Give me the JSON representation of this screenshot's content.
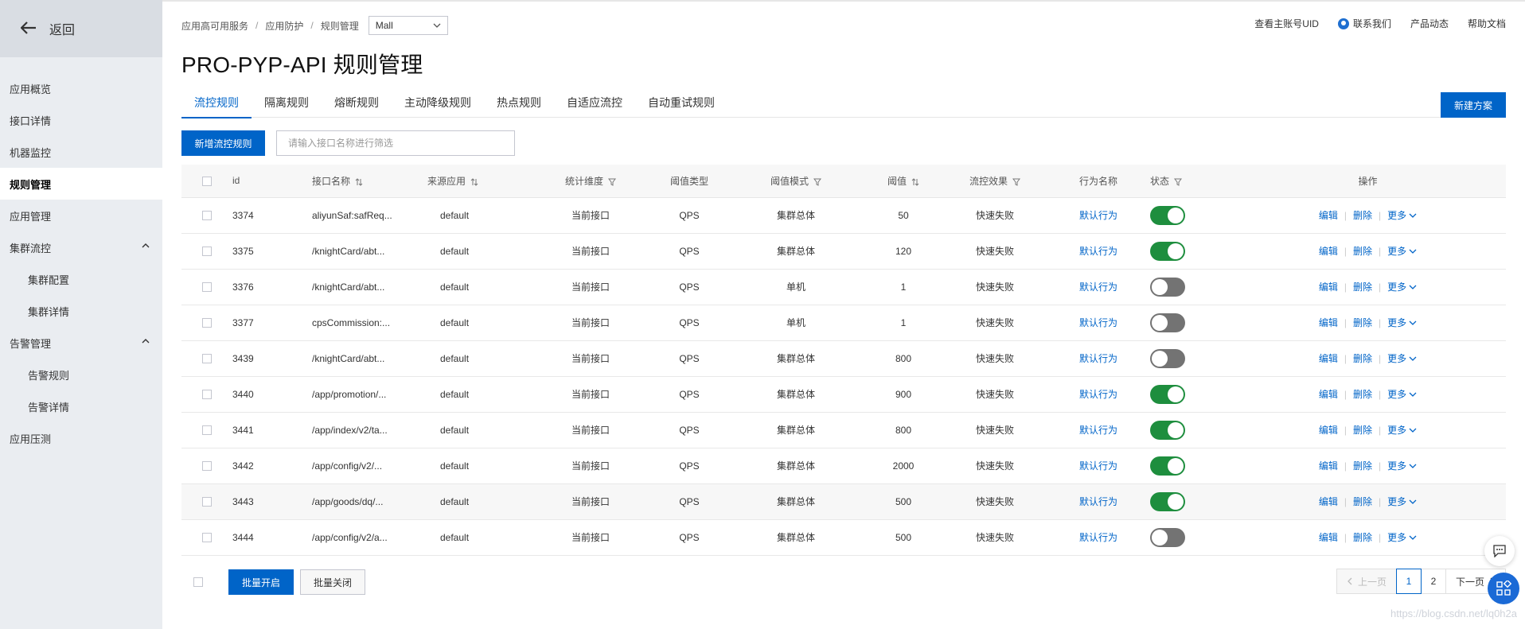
{
  "sidebar": {
    "back_label": "返回",
    "items": [
      {
        "label": "应用概览"
      },
      {
        "label": "接口详情"
      },
      {
        "label": "机器监控"
      },
      {
        "label": "规则管理"
      },
      {
        "label": "应用管理"
      },
      {
        "label": "集群流控"
      },
      {
        "label": "集群配置"
      },
      {
        "label": "集群详情"
      },
      {
        "label": "告警管理"
      },
      {
        "label": "告警规则"
      },
      {
        "label": "告警详情"
      },
      {
        "label": "应用压测"
      }
    ]
  },
  "breadcrumb": {
    "items": [
      "应用高可用服务",
      "应用防护",
      "规则管理"
    ],
    "separator": "/",
    "app_select_value": "Mall"
  },
  "top_links": {
    "uid": "查看主账号UID",
    "contact": "联系我们",
    "news": "产品动态",
    "help": "帮助文档"
  },
  "page_title": "PRO-PYP-API 规则管理",
  "tabs": [
    {
      "label": "流控规则"
    },
    {
      "label": "隔离规则"
    },
    {
      "label": "熔断规则"
    },
    {
      "label": "主动降级规则"
    },
    {
      "label": "热点规则"
    },
    {
      "label": "自适应流控"
    },
    {
      "label": "自动重试规则"
    }
  ],
  "new_plan_label": "新建方案",
  "toolbar": {
    "add_label": "新增流控规则",
    "filter_placeholder": "请输入接口名称进行筛选"
  },
  "table": {
    "headers": {
      "id": "id",
      "name": "接口名称",
      "source": "来源应用",
      "dimension": "统计维度",
      "threshold_type": "阈值类型",
      "threshold_mode": "阈值模式",
      "threshold": "阈值",
      "effect": "流控效果",
      "action": "行为名称",
      "status": "状态",
      "ops": "操作"
    },
    "ops_labels": {
      "edit": "编辑",
      "delete": "删除",
      "more": "更多"
    },
    "rows": [
      {
        "id": "3374",
        "name": "aliyunSaf:safReq...",
        "source": "default",
        "dimension": "当前接口",
        "threshold_type": "QPS",
        "threshold_mode": "集群总体",
        "threshold": "50",
        "effect": "快速失败",
        "action": "默认行为",
        "status": "on"
      },
      {
        "id": "3375",
        "name": "/knightCard/abt...",
        "source": "default",
        "dimension": "当前接口",
        "threshold_type": "QPS",
        "threshold_mode": "集群总体",
        "threshold": "120",
        "effect": "快速失败",
        "action": "默认行为",
        "status": "on"
      },
      {
        "id": "3376",
        "name": "/knightCard/abt...",
        "source": "default",
        "dimension": "当前接口",
        "threshold_type": "QPS",
        "threshold_mode": "单机",
        "threshold": "1",
        "effect": "快速失败",
        "action": "默认行为",
        "status": "off"
      },
      {
        "id": "3377",
        "name": "cpsCommission:...",
        "source": "default",
        "dimension": "当前接口",
        "threshold_type": "QPS",
        "threshold_mode": "单机",
        "threshold": "1",
        "effect": "快速失败",
        "action": "默认行为",
        "status": "off"
      },
      {
        "id": "3439",
        "name": "/knightCard/abt...",
        "source": "default",
        "dimension": "当前接口",
        "threshold_type": "QPS",
        "threshold_mode": "集群总体",
        "threshold": "800",
        "effect": "快速失败",
        "action": "默认行为",
        "status": "off"
      },
      {
        "id": "3440",
        "name": "/app/promotion/...",
        "source": "default",
        "dimension": "当前接口",
        "threshold_type": "QPS",
        "threshold_mode": "集群总体",
        "threshold": "900",
        "effect": "快速失败",
        "action": "默认行为",
        "status": "on"
      },
      {
        "id": "3441",
        "name": "/app/index/v2/ta...",
        "source": "default",
        "dimension": "当前接口",
        "threshold_type": "QPS",
        "threshold_mode": "集群总体",
        "threshold": "800",
        "effect": "快速失败",
        "action": "默认行为",
        "status": "on"
      },
      {
        "id": "3442",
        "name": "/app/config/v2/...",
        "source": "default",
        "dimension": "当前接口",
        "threshold_type": "QPS",
        "threshold_mode": "集群总体",
        "threshold": "2000",
        "effect": "快速失败",
        "action": "默认行为",
        "status": "on"
      },
      {
        "id": "3443",
        "name": "/app/goods/dq/...",
        "source": "default",
        "dimension": "当前接口",
        "threshold_type": "QPS",
        "threshold_mode": "集群总体",
        "threshold": "500",
        "effect": "快速失败",
        "action": "默认行为",
        "status": "on"
      },
      {
        "id": "3444",
        "name": "/app/config/v2/a...",
        "source": "default",
        "dimension": "当前接口",
        "threshold_type": "QPS",
        "threshold_mode": "集群总体",
        "threshold": "500",
        "effect": "快速失败",
        "action": "默认行为",
        "status": "off"
      }
    ]
  },
  "footer": {
    "batch_on": "批量开启",
    "batch_off": "批量关闭",
    "pager": {
      "prev": "上一页",
      "pages": [
        "1",
        "2"
      ],
      "next": "下一页",
      "current": "1"
    }
  },
  "watermark": "https://blog.csdn.net/lq0h2a",
  "colors": {
    "primary": "#0064c8",
    "switch_on": "#1e8e3e",
    "switch_off": "#737373",
    "sidebar_bg": "#eaedf1",
    "brand_accent": "#ff6a00"
  },
  "icons": [
    "arrow-left-icon",
    "chevron-up-icon",
    "chevron-down-icon",
    "sort-icon",
    "filter-icon",
    "contact-icon",
    "chat-icon",
    "apps-icon"
  ]
}
